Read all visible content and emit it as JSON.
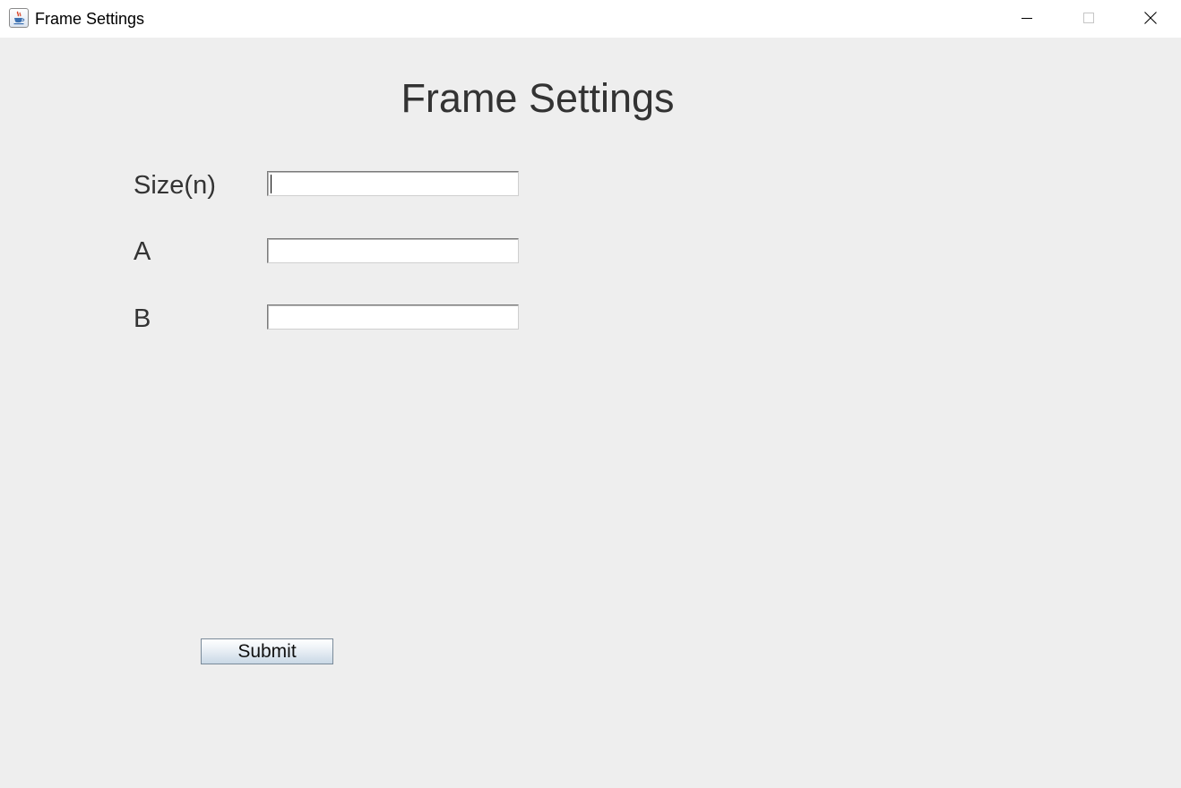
{
  "window": {
    "title": "Frame Settings",
    "icon": "java-cup-icon",
    "controls": [
      "minimize-icon",
      "maximize-icon",
      "close-icon"
    ]
  },
  "form": {
    "heading": "Frame Settings",
    "fields": [
      {
        "label": "Size(n)",
        "value": "",
        "placeholder": "",
        "focused": true
      },
      {
        "label": "A",
        "value": "",
        "placeholder": ""
      },
      {
        "label": "B",
        "value": "",
        "placeholder": ""
      }
    ],
    "submit_label": "Submit"
  },
  "colors": {
    "background": "#eeeeee",
    "titlebar": "#ffffff",
    "text": "#333333"
  }
}
